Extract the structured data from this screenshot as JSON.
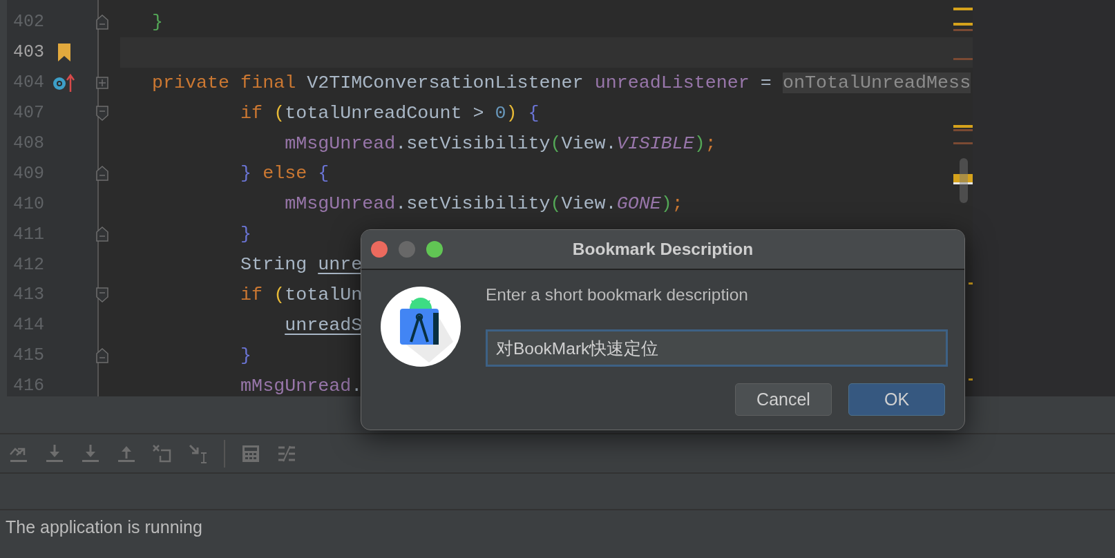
{
  "editor": {
    "lines": [
      {
        "number": "402",
        "current": false,
        "fold": {
          "kind": "end"
        },
        "tokens": [
          {
            "kind": "bracket",
            "color": "#54a857",
            "text": "}"
          }
        ]
      },
      {
        "number": "403",
        "current": true,
        "gutter_icon": {
          "kind": "bookmark"
        }
      },
      {
        "number": "404",
        "current": false,
        "gutter_icon": {
          "kind": "implements"
        },
        "fold": {
          "kind": "collapsed"
        },
        "tokens": [
          {
            "kind": "keyword",
            "text": "private final "
          },
          {
            "kind": "plain",
            "text": "V2TIMConversationListener "
          },
          {
            "kind": "field",
            "text": "unreadListener"
          },
          {
            "kind": "plain",
            "text": " = "
          },
          {
            "kind": "hint",
            "text": "onTotalUnreadMess"
          }
        ],
        "children": [
          {
            "number": "407",
            "current": false,
            "fold": {
              "kind": "start"
            },
            "tokens": [
              {
                "kind": "keyword",
                "text": "if "
              },
              {
                "kind": "bracket",
                "color": "#e8ba36",
                "text": "("
              },
              {
                "kind": "plain",
                "text": "totalUnreadCount > "
              },
              {
                "kind": "number",
                "text": "0"
              },
              {
                "kind": "bracket",
                "color": "#e8ba36",
                "text": ")"
              },
              {
                "kind": "bracket",
                "color": "#6b75d6",
                "text": " {"
              }
            ],
            "children": [
              {
                "number": "408",
                "current": false,
                "tokens": [
                  {
                    "kind": "field",
                    "text": "mMsgUnread"
                  },
                  {
                    "kind": "plain",
                    "text": ".setVisibility"
                  },
                  {
                    "kind": "bracket",
                    "color": "#54a857",
                    "text": "("
                  },
                  {
                    "kind": "plain",
                    "text": "View."
                  },
                  {
                    "kind": "constant",
                    "text": "VISIBLE"
                  },
                  {
                    "kind": "bracket",
                    "color": "#54a857",
                    "text": ")"
                  },
                  {
                    "kind": "keyword",
                    "text": ";"
                  }
                ]
              }
            ]
          },
          {
            "number": "409",
            "current": false,
            "fold": {
              "kind": "end"
            },
            "tokens": [
              {
                "kind": "bracket",
                "color": "#6b75d6",
                "text": "}"
              },
              {
                "kind": "keyword",
                "text": " else "
              },
              {
                "kind": "bracket",
                "color": "#6b75d6",
                "text": "{"
              }
            ],
            "children": [
              {
                "number": "410",
                "current": false,
                "tokens": [
                  {
                    "kind": "field",
                    "text": "mMsgUnread"
                  },
                  {
                    "kind": "plain",
                    "text": ".setVisibility"
                  },
                  {
                    "kind": "bracket",
                    "color": "#54a857",
                    "text": "("
                  },
                  {
                    "kind": "plain",
                    "text": "View."
                  },
                  {
                    "kind": "constant",
                    "text": "GONE"
                  },
                  {
                    "kind": "bracket",
                    "color": "#54a857",
                    "text": ")"
                  },
                  {
                    "kind": "keyword",
                    "text": ";"
                  }
                ]
              }
            ]
          },
          {
            "number": "411",
            "current": false,
            "fold": {
              "kind": "end"
            },
            "tokens": [
              {
                "kind": "bracket",
                "color": "#6b75d6",
                "text": "}"
              }
            ]
          },
          {
            "number": "412",
            "current": false,
            "tokens": [
              {
                "kind": "plain",
                "text": "String "
              },
              {
                "kind": "local",
                "text": "unre"
              }
            ]
          },
          {
            "number": "413",
            "current": false,
            "fold": {
              "kind": "start"
            },
            "tokens": [
              {
                "kind": "keyword",
                "text": "if "
              },
              {
                "kind": "bracket",
                "color": "#e8ba36",
                "text": "("
              },
              {
                "kind": "plain",
                "text": "totalUn"
              }
            ],
            "children": [
              {
                "number": "414",
                "current": false,
                "tokens": [
                  {
                    "kind": "local",
                    "text": "unreadS"
                  }
                ]
              }
            ]
          },
          {
            "number": "415",
            "current": false,
            "fold": {
              "kind": "end"
            },
            "tokens": [
              {
                "kind": "bracket",
                "color": "#6b75d6",
                "text": "}"
              }
            ]
          },
          {
            "number": "416",
            "current": false,
            "tokens": [
              {
                "kind": "field",
                "text": "mMsgUnread"
              },
              {
                "kind": "plain",
                "text": "."
              }
            ]
          }
        ]
      }
    ]
  },
  "toolbar": {
    "buttons": [
      {
        "kind": "showpoint",
        "disabled": true
      },
      {
        "kind": "stepinto",
        "disabled": true
      },
      {
        "kind": "forceinto",
        "disabled": true
      },
      {
        "kind": "stepout",
        "disabled": true
      },
      {
        "kind": "dropframe",
        "disabled": true
      },
      {
        "kind": "runtocursor",
        "disabled": true
      },
      {
        "kind": "separator"
      },
      {
        "kind": "evaluate",
        "disabled": true
      },
      {
        "kind": "trace",
        "disabled": true
      }
    ]
  },
  "status_bar": {
    "text": "The application is running"
  },
  "dialog": {
    "title": "Bookmark Description",
    "window_buttons": [
      {
        "kind": "close",
        "disabled": false
      },
      {
        "kind": "minimize",
        "disabled": true
      },
      {
        "kind": "zoom",
        "disabled": false
      }
    ],
    "prompt": "Enter a short bookmark description",
    "input": {
      "value": "对BookMark快速定位",
      "focused": true
    },
    "buttons": [
      {
        "label": "Cancel",
        "default": false
      },
      {
        "label": "OK",
        "default": true
      }
    ]
  }
}
